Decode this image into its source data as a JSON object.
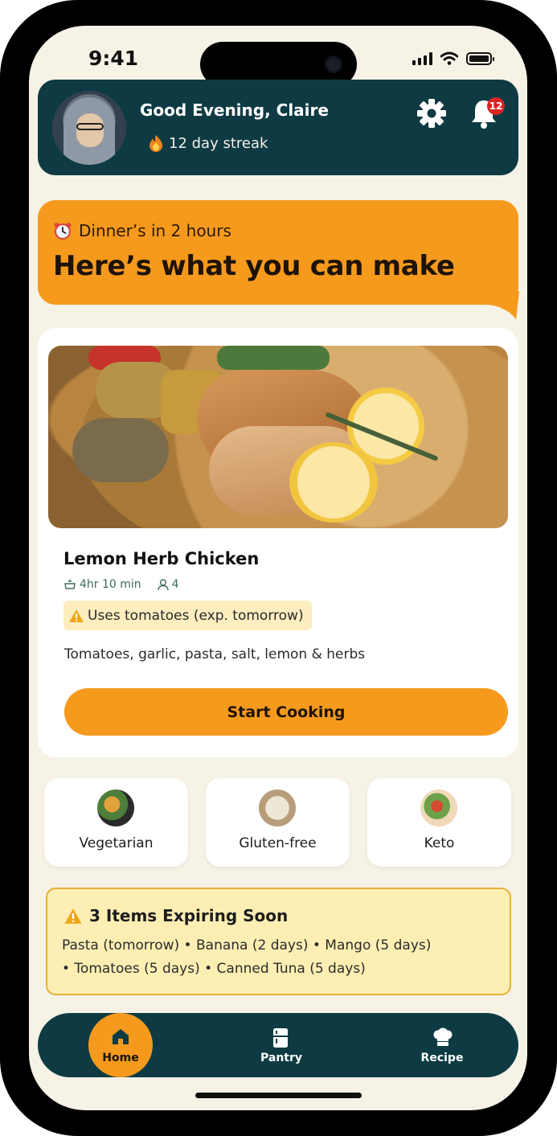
{
  "status_bar": {
    "time": "9:41"
  },
  "header": {
    "greeting": "Good Evening, Claire",
    "streak": "12 day streak",
    "notification_count": "12"
  },
  "banner": {
    "subtitle": "Dinner’s in 2 hours",
    "headline": "Here’s what you can make"
  },
  "recipe": {
    "title": "Lemon Herb Chicken",
    "time": "4hr 10 min",
    "servings": "4",
    "warning": "Uses tomatoes (exp. tomorrow)",
    "ingredients": "Tomatoes, garlic, pasta, salt, lemon & herbs",
    "cta": "Start Cooking"
  },
  "diets": [
    {
      "label": "Vegetarian"
    },
    {
      "label": "Gluten-free"
    },
    {
      "label": "Keto"
    }
  ],
  "expiring": {
    "title": "3 Items Expiring Soon",
    "line1": "Pasta (tomorrow) • Banana (2 days) • Mango (5 days)",
    "line2": "• Tomatoes (5 days) • Canned Tuna (5 days)"
  },
  "nav": {
    "items": [
      {
        "label": "Home",
        "active": true
      },
      {
        "label": "Pantry",
        "active": false
      },
      {
        "label": "Recipe",
        "active": false
      }
    ]
  },
  "colors": {
    "primary_dark": "#0e3b43",
    "accent_orange": "#f69a1d",
    "background": "#f6f2e6",
    "warning_bg": "#fdeeb3",
    "badge_red": "#e02424"
  }
}
